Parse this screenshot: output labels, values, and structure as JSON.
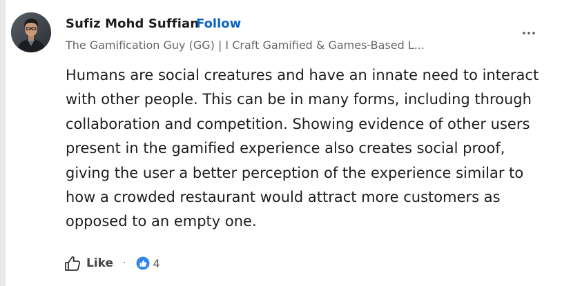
{
  "author": {
    "name": "Sufiz Mohd Suffian",
    "follow_label": "Follow",
    "headline": "The Gamification Guy (GG) | I Craft Gamified & Games-Based L..."
  },
  "more_menu_label": "...",
  "comment": {
    "text": "Humans are social creatures and have an innate need to interact with other people. This can be in many forms, including through collaboration and competition. Showing evidence of other users present in the gamified experience also creates social proof, giving the user a better perception of the experience similar to how a crowded restaurant would attract more customers as opposed to an empty one."
  },
  "actions": {
    "like_label": "Like",
    "separator": "·",
    "reaction_count": "4"
  },
  "colors": {
    "link_blue": "#0a66c2",
    "text_primary": "#1d1d1d",
    "text_secondary": "#666666"
  },
  "icons": {
    "like": "thumbs-up-outline-icon",
    "reaction": "like-reaction-icon",
    "more": "ellipsis-icon"
  }
}
